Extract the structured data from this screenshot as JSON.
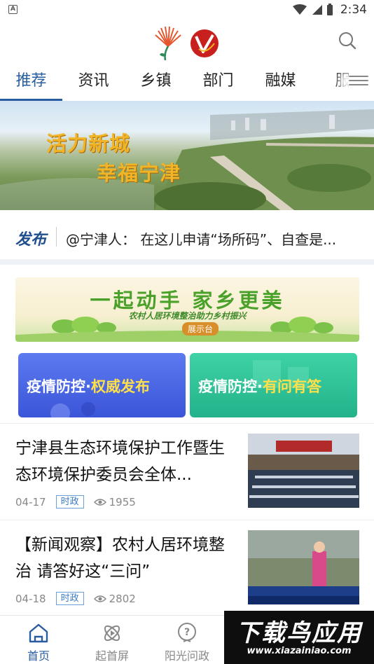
{
  "status_bar": {
    "time": "2:34"
  },
  "tabs": [
    {
      "label": "推荐",
      "active": true
    },
    {
      "label": "资讯"
    },
    {
      "label": "乡镇"
    },
    {
      "label": "部门"
    },
    {
      "label": "融媒"
    },
    {
      "label": "服"
    }
  ],
  "banner": {
    "line1": "活力新城",
    "line2": "幸福宁津"
  },
  "notice": {
    "logo": "发布",
    "text": "@宁津人： 在这儿申请“场所码”、自查是..."
  },
  "promo": {
    "title": "一起动手  家乡更美",
    "subtitle": "农村人居环境整治助力乡村振兴",
    "badge": "展示台"
  },
  "cards": [
    {
      "prefix": "疫情防控·",
      "highlight": "权威发布"
    },
    {
      "prefix": "疫情防控·",
      "highlight": "有问有答"
    }
  ],
  "news": [
    {
      "title": "宁津县生态环境保护工作暨生态环境保护委员会全体...",
      "date": "04-17",
      "tag": "时政",
      "views": "1955"
    },
    {
      "title": "【新闻观察】农村人居环境整治 请答好这“三问”",
      "date": "04-18",
      "tag": "时政",
      "views": "2802"
    }
  ],
  "bottom_nav": [
    {
      "label": "首页",
      "icon": "home-icon",
      "active": true
    },
    {
      "label": "起首屏",
      "icon": "atom-icon"
    },
    {
      "label": "阳光问政",
      "icon": "question-icon"
    }
  ],
  "watermark": {
    "main": "下载鸟应用",
    "sub": "www.xiazainiao.com"
  },
  "colors": {
    "accent": "#2a5d9f",
    "tag_blue": "#3b7bc4",
    "card_blue": "#3b55d8",
    "card_green": "#23b28a",
    "promo_green": "#4aa12a"
  }
}
